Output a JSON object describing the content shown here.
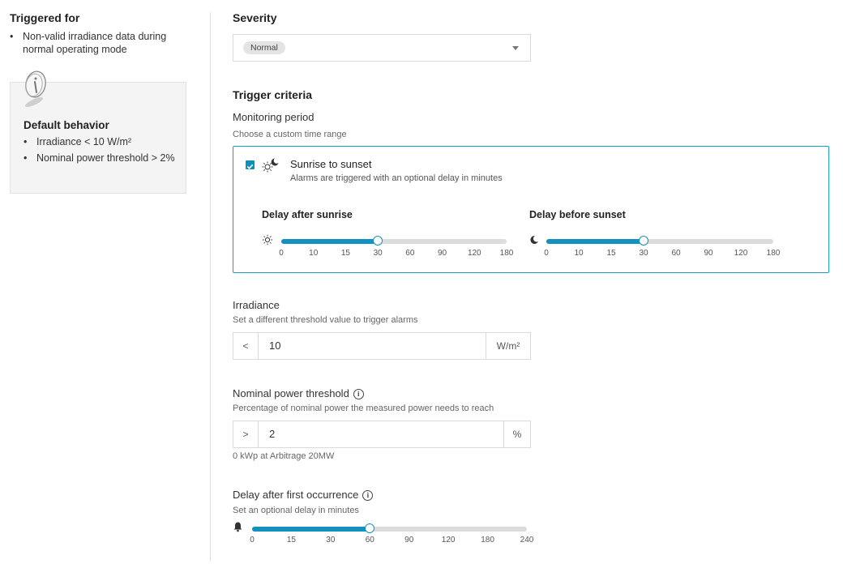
{
  "left": {
    "triggered_title": "Triggered for",
    "triggered_items": [
      "Non-valid irradiance data during normal operating mode"
    ],
    "default_title": "Default behavior",
    "default_items": [
      "Irradiance < 10 W/m²",
      "Nominal power threshold > 2%"
    ]
  },
  "severity": {
    "title": "Severity",
    "value": "Normal"
  },
  "trigger": {
    "title": "Trigger criteria",
    "monitoring_label": "Monitoring period",
    "monitoring_sub": "Choose a custom time range",
    "option_title": "Sunrise to sunset",
    "option_sub": "Alarms are triggered with an optional delay in minutes",
    "option_checked": true,
    "sunrise": {
      "title": "Delay after sunrise",
      "ticks": [
        "0",
        "10",
        "15",
        "30",
        "60",
        "90",
        "120",
        "180"
      ],
      "value": "30"
    },
    "sunset": {
      "title": "Delay before sunset",
      "ticks": [
        "0",
        "10",
        "15",
        "30",
        "60",
        "90",
        "120",
        "180"
      ],
      "value": "30"
    }
  },
  "irradiance": {
    "label": "Irradiance",
    "sub": "Set a different threshold value to trigger alarms",
    "operator": "<",
    "value": "10",
    "unit": "W/m²"
  },
  "nominal": {
    "label": "Nominal power threshold",
    "sub": "Percentage of nominal power the measured power needs to reach",
    "operator": ">",
    "value": "2",
    "unit": "%",
    "note": "0 kWp at Arbitrage 20MW"
  },
  "delay": {
    "label": "Delay after first occurrence",
    "sub": "Set an optional delay in minutes",
    "ticks": [
      "0",
      "15",
      "30",
      "60",
      "90",
      "120",
      "180",
      "240"
    ],
    "value": "60"
  },
  "colors": {
    "accent": "#1591bf",
    "border": "#dadada",
    "box_bg": "#f4f4f4"
  },
  "icons": {
    "info": "info-icon",
    "sun": "sun-icon",
    "moon": "moon-icon",
    "bell": "bell-icon",
    "sun_moon": "sun-moon-icon",
    "caret": "chevron-down-icon"
  }
}
